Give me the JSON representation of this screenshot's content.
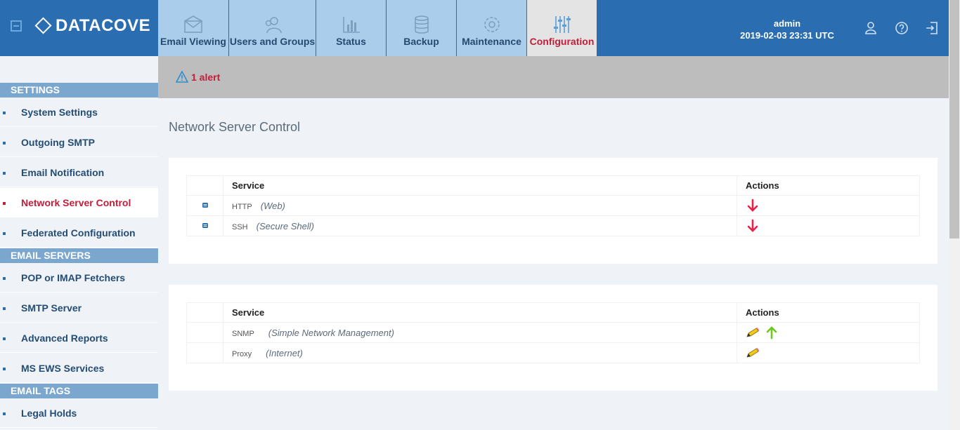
{
  "brand": {
    "name": "DATACOVE"
  },
  "tabs": [
    {
      "label": "Email Viewing",
      "icon": "envelope-icon",
      "active": false
    },
    {
      "label": "Users and Groups",
      "icon": "users-icon",
      "active": false
    },
    {
      "label": "Status",
      "icon": "bar-chart-icon",
      "active": false
    },
    {
      "label": "Backup",
      "icon": "database-icon",
      "active": false
    },
    {
      "label": "Maintenance",
      "icon": "gear-icon",
      "active": false
    },
    {
      "label": "Configuration",
      "icon": "sliders-icon",
      "active": true
    }
  ],
  "user": {
    "name": "admin",
    "datetime": "2019-02-03 23:31 UTC"
  },
  "sidebar": {
    "sections": [
      {
        "title": "SETTINGS",
        "items": [
          {
            "label": "System Settings"
          },
          {
            "label": "Outgoing SMTP"
          },
          {
            "label": "Email Notification"
          },
          {
            "label": "Network Server Control",
            "active": true
          },
          {
            "label": "Federated Configuration"
          }
        ]
      },
      {
        "title": "EMAIL SERVERS",
        "items": [
          {
            "label": "POP or IMAP Fetchers"
          },
          {
            "label": "SMTP Server"
          },
          {
            "label": "Advanced Reports"
          },
          {
            "label": "MS EWS Services"
          }
        ]
      },
      {
        "title": "EMAIL TAGS",
        "items": [
          {
            "label": "Legal Holds"
          }
        ]
      }
    ]
  },
  "alert": {
    "text": "1 alert"
  },
  "page": {
    "title": "Network Server Control"
  },
  "tables": [
    {
      "headers": {
        "service": "Service",
        "actions": "Actions"
      },
      "rows": [
        {
          "name": "HTTP",
          "desc": "(Web)",
          "status_icon": "server-icon",
          "actions": [
            "arrow-down-icon"
          ]
        },
        {
          "name": "SSH",
          "desc": "(Secure Shell)",
          "status_icon": "server-icon",
          "actions": [
            "arrow-down-icon"
          ]
        }
      ]
    },
    {
      "headers": {
        "service": "Service",
        "actions": "Actions"
      },
      "rows": [
        {
          "name": "SNMP",
          "desc": "(Simple Network Management)",
          "status_icon": "",
          "actions": [
            "pencil-icon",
            "arrow-up-icon"
          ]
        },
        {
          "name": "Proxy",
          "desc": "(Internet)",
          "status_icon": "",
          "actions": [
            "pencil-icon"
          ]
        }
      ]
    }
  ],
  "colors": {
    "brand_blue": "#2a6db1",
    "tab_bg": "#aacdec",
    "accent_red": "#c21d3a",
    "section_bg": "#7ba7ce"
  }
}
